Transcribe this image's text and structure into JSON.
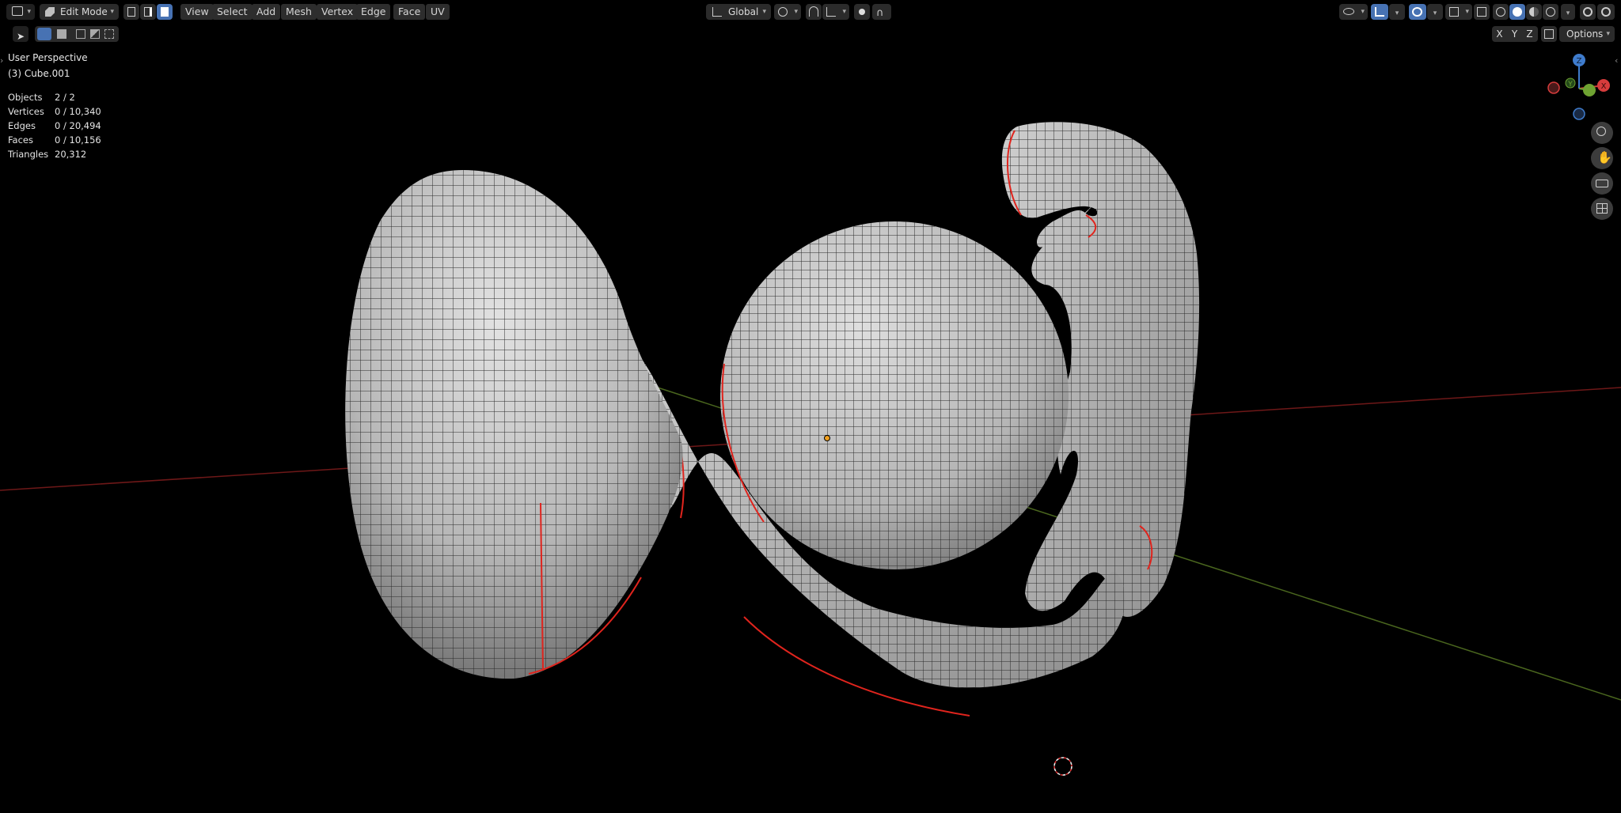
{
  "header": {
    "mode_label": "Edit Mode",
    "menus": [
      "View",
      "Select",
      "Add",
      "Mesh",
      "Vertex",
      "Edge",
      "Face",
      "UV"
    ],
    "transform_orientation": "Global",
    "axis_labels": [
      "X",
      "Y",
      "Z"
    ],
    "options_label": "Options"
  },
  "overlay": {
    "view_name": "User Perspective",
    "object_name": "(3) Cube.001",
    "stats": [
      {
        "label": "Objects",
        "value": "2 / 2"
      },
      {
        "label": "Vertices",
        "value": "0 / 10,340"
      },
      {
        "label": "Edges",
        "value": "0 / 20,494"
      },
      {
        "label": "Faces",
        "value": "0 / 10,156"
      },
      {
        "label": "Triangles",
        "value": "20,312"
      }
    ]
  },
  "gizmo": {
    "x_label": "X",
    "y_label": "Y",
    "z_label": "Z"
  },
  "colors": {
    "background": "#000000",
    "mesh": "#b9b9b9",
    "seam": "#e0241d",
    "x_axis": "#7a1a1a",
    "y_axis": "#4c6a1f",
    "accent": "#4772b3",
    "gizmo_x": "#d63c3c",
    "gizmo_y": "#6fa332",
    "gizmo_z": "#3f7ccd"
  },
  "icons": [
    "editor-type-icon",
    "edit-mode-icon",
    "vertex-select-icon",
    "edge-select-icon",
    "face-select-icon",
    "select-box-icon",
    "transform-orientation-icon",
    "pivot-icon",
    "snap-icon",
    "proportional-edit-icon",
    "visibility-icon",
    "gizmo-icon",
    "overlay-icon",
    "xray-icon",
    "shading-solid-icon",
    "shading-material-icon",
    "shading-rendered-icon",
    "zoom-icon",
    "pan-icon",
    "camera-icon",
    "perspective-grid-icon",
    "3d-cursor-icon"
  ]
}
